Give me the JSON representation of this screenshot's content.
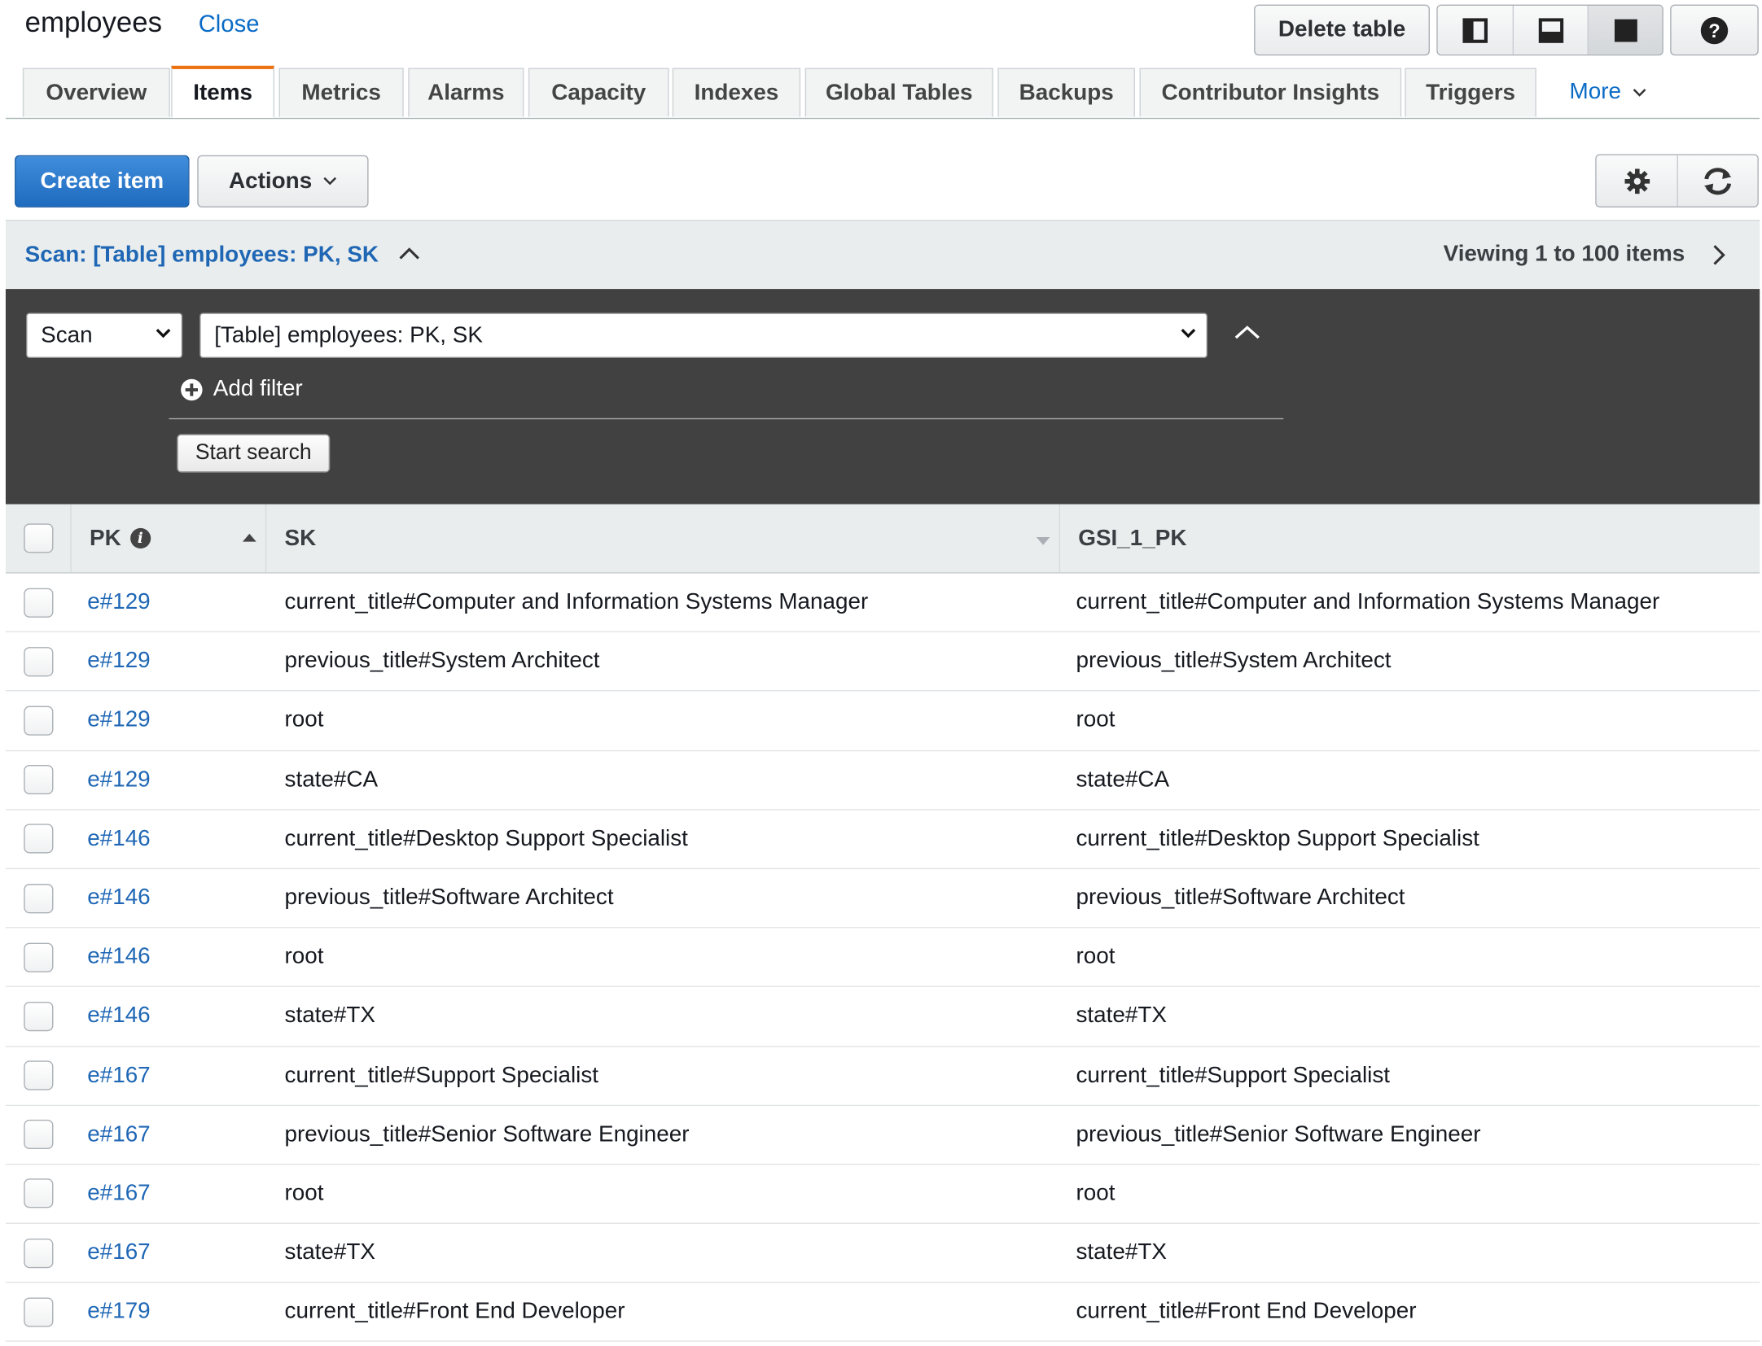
{
  "header": {
    "table_name": "employees",
    "close_label": "Close",
    "delete_label": "Delete table",
    "help_symbol": "?"
  },
  "tabs": [
    {
      "label": "Overview"
    },
    {
      "label": "Items"
    },
    {
      "label": "Metrics"
    },
    {
      "label": "Alarms"
    },
    {
      "label": "Capacity"
    },
    {
      "label": "Indexes"
    },
    {
      "label": "Global Tables"
    },
    {
      "label": "Backups"
    },
    {
      "label": "Contributor Insights"
    },
    {
      "label": "Triggers"
    },
    {
      "label": "More"
    }
  ],
  "active_tab": "Items",
  "toolbar": {
    "create_label": "Create item",
    "actions_label": "Actions"
  },
  "scan": {
    "title": "Scan: [Table] employees: PK, SK",
    "viewing": "Viewing 1 to 100 items",
    "mode_value": "Scan",
    "target_value": "[Table] employees: PK, SK",
    "add_filter_label": "Add filter",
    "start_label": "Start search"
  },
  "table": {
    "columns": [
      "PK",
      "SK",
      "GSI_1_PK"
    ],
    "rows": [
      {
        "pk": "e#129",
        "sk": "current_title#Computer and Information Systems Manager",
        "gsi": "current_title#Computer and Information Systems Manager"
      },
      {
        "pk": "e#129",
        "sk": "previous_title#System Architect",
        "gsi": "previous_title#System Architect"
      },
      {
        "pk": "e#129",
        "sk": "root",
        "gsi": "root"
      },
      {
        "pk": "e#129",
        "sk": "state#CA",
        "gsi": "state#CA"
      },
      {
        "pk": "e#146",
        "sk": "current_title#Desktop Support Specialist",
        "gsi": "current_title#Desktop Support Specialist"
      },
      {
        "pk": "e#146",
        "sk": "previous_title#Software Architect",
        "gsi": "previous_title#Software Architect"
      },
      {
        "pk": "e#146",
        "sk": "root",
        "gsi": "root"
      },
      {
        "pk": "e#146",
        "sk": "state#TX",
        "gsi": "state#TX"
      },
      {
        "pk": "e#167",
        "sk": "current_title#Support Specialist",
        "gsi": "current_title#Support Specialist"
      },
      {
        "pk": "e#167",
        "sk": "previous_title#Senior Software Engineer",
        "gsi": "previous_title#Senior Software Engineer"
      },
      {
        "pk": "e#167",
        "sk": "root",
        "gsi": "root"
      },
      {
        "pk": "e#167",
        "sk": "state#TX",
        "gsi": "state#TX"
      },
      {
        "pk": "e#179",
        "sk": "current_title#Front End Developer",
        "gsi": "current_title#Front End Developer"
      }
    ]
  },
  "colors": {
    "link": "#0a6bc6",
    "primary_button": "#1f6bbf",
    "active_tab_accent": "#ec7211",
    "scan_panel_bg": "#414141"
  }
}
